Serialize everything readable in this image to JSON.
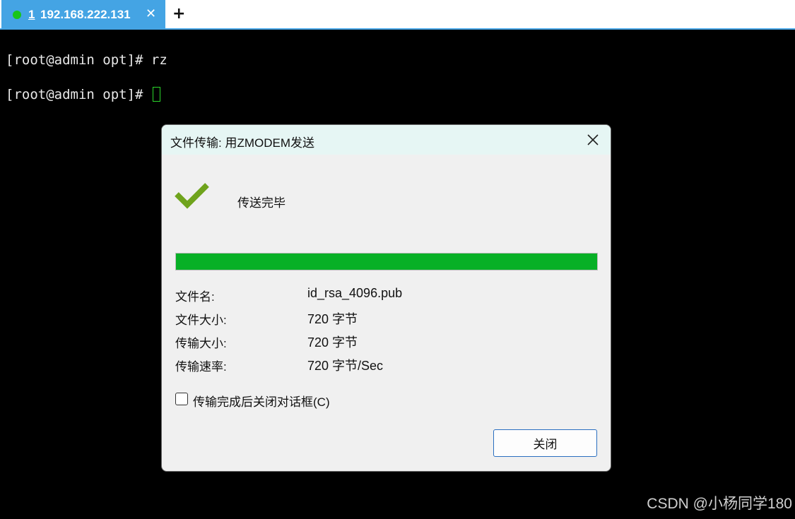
{
  "tabs": [
    {
      "number": "1",
      "title": "192.168.222.131",
      "close_icon": "close-icon",
      "active": true
    }
  ],
  "new_tab_icon": "plus-icon",
  "terminal": {
    "lines": [
      "[root@admin opt]# rz",
      "[root@admin opt]# "
    ]
  },
  "dialog": {
    "title": "文件传输: 用ZMODEM发送",
    "status_icon": "checkmark-icon",
    "status": "传送完毕",
    "progress": 1.0,
    "info": [
      {
        "label": "文件名:",
        "value": "id_rsa_4096.pub"
      },
      {
        "label": "文件大小:",
        "value": "720 字节"
      },
      {
        "label": "传输大小:",
        "value": "720 字节"
      },
      {
        "label": "传输速率:",
        "value": "720 字节/Sec"
      }
    ],
    "auto_close_checkbox": {
      "label": "传输完成后关闭对话框(C)",
      "checked": false
    },
    "close_button": "关闭"
  },
  "watermark": "CSDN @小杨同学180",
  "colors": {
    "tab_active": "#44a4e4",
    "status_dot": "#19c519",
    "progress": "#07b026",
    "check": "#6fa31c",
    "cursor": "#2bd62b"
  }
}
